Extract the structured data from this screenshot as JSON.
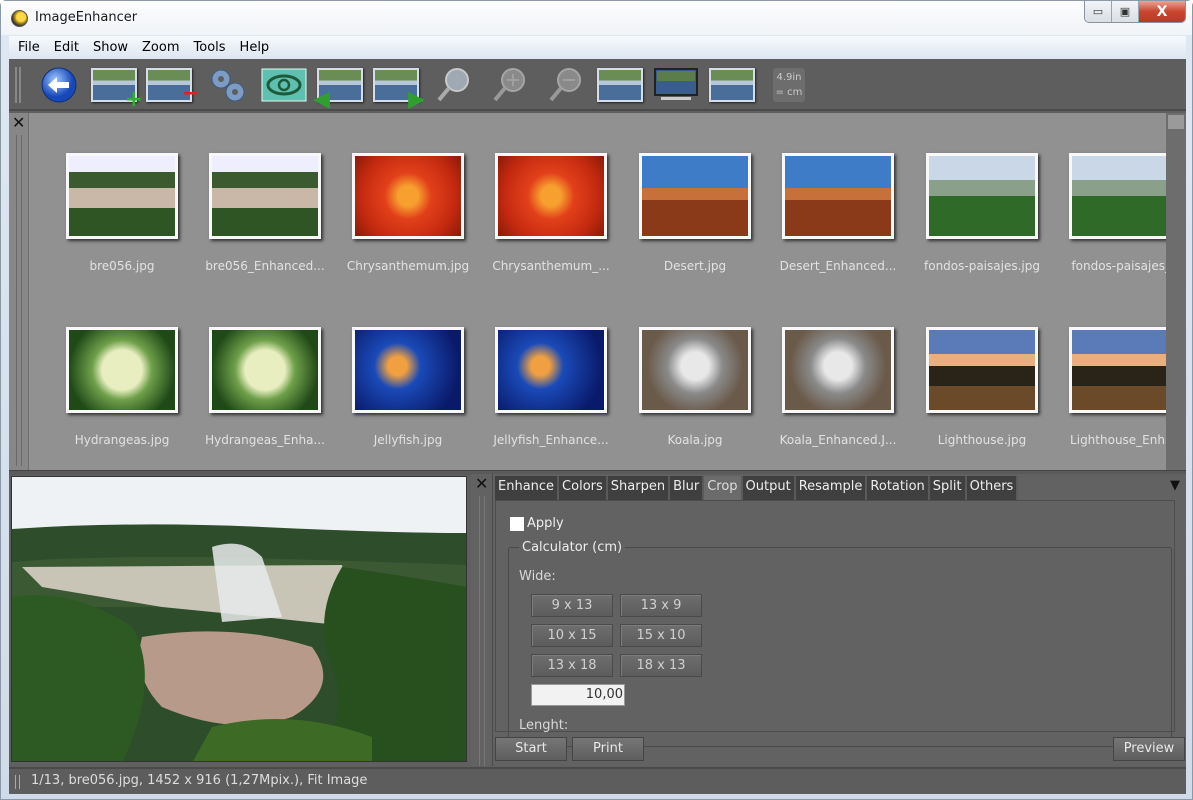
{
  "window": {
    "title": "ImageEnhancer",
    "minimize": "▭",
    "maximize": "▣",
    "close": "X"
  },
  "menu": [
    "File",
    "Edit",
    "Show",
    "Zoom",
    "Tools",
    "Help"
  ],
  "toolbar": {
    "buttons": [
      {
        "name": "back-button",
        "icon": "back-arrow-icon"
      },
      {
        "name": "add-image-button",
        "icon": "add-image-icon"
      },
      {
        "name": "remove-image-button",
        "icon": "remove-image-icon"
      },
      {
        "name": "settings-button",
        "icon": "gears-icon"
      },
      {
        "name": "view-button",
        "icon": "eye-icon"
      },
      {
        "name": "previous-image-button",
        "icon": "previous-image-icon"
      },
      {
        "name": "next-image-button",
        "icon": "next-image-icon"
      },
      {
        "name": "zoom-fit-button",
        "icon": "magnifier-icon"
      },
      {
        "name": "zoom-in-button",
        "icon": "zoom-in-icon"
      },
      {
        "name": "zoom-out-button",
        "icon": "zoom-out-icon"
      },
      {
        "name": "fit-image-button",
        "icon": "fit-image-icon"
      },
      {
        "name": "fullscreen-button",
        "icon": "monitor-icon"
      },
      {
        "name": "actual-size-button",
        "icon": "actual-size-icon"
      }
    ],
    "unit_top": "4.9in",
    "unit_bottom": "= cm"
  },
  "thumbnails": [
    {
      "caption": "bre056.jpg",
      "theme": "waterfall"
    },
    {
      "caption": "bre056_Enhanced...",
      "theme": "waterfall"
    },
    {
      "caption": "Chrysanthemum.jpg",
      "theme": "flower"
    },
    {
      "caption": "Chrysanthemum_...",
      "theme": "flower"
    },
    {
      "caption": "Desert.jpg",
      "theme": "desert"
    },
    {
      "caption": "Desert_Enhanced...",
      "theme": "desert"
    },
    {
      "caption": "fondos-paisajes.jpg",
      "theme": "mountain"
    },
    {
      "caption": "fondos-paisajes_E",
      "theme": "mountain"
    },
    {
      "caption": "Hydrangeas.jpg",
      "theme": "hydrangea"
    },
    {
      "caption": "Hydrangeas_Enha...",
      "theme": "hydrangea"
    },
    {
      "caption": "Jellyfish.jpg",
      "theme": "jellyfish"
    },
    {
      "caption": "Jellyfish_Enhance...",
      "theme": "jellyfish"
    },
    {
      "caption": "Koala.jpg",
      "theme": "koala"
    },
    {
      "caption": "Koala_Enhanced.J...",
      "theme": "koala"
    },
    {
      "caption": "Lighthouse.jpg",
      "theme": "lighthouse"
    },
    {
      "caption": "Lighthouse_Enhan",
      "theme": "lighthouse"
    }
  ],
  "tabs": [
    {
      "label": "Enhance",
      "active": false
    },
    {
      "label": "Colors",
      "active": false
    },
    {
      "label": "Sharpen",
      "active": false
    },
    {
      "label": "Blur",
      "active": false
    },
    {
      "label": "Crop",
      "active": true
    },
    {
      "label": "Output",
      "active": false
    },
    {
      "label": "Resample",
      "active": false
    },
    {
      "label": "Rotation",
      "active": false
    },
    {
      "label": "Split",
      "active": false
    },
    {
      "label": "Others",
      "active": false
    }
  ],
  "crop": {
    "apply_label": "Apply",
    "apply_checked": false,
    "calculator_label": "Calculator (cm)",
    "wide_label": "Wide:",
    "presets": [
      "9 x 13",
      "13 x 9",
      "10 x 15",
      "15 x 10",
      "13 x 18",
      "18 x 13"
    ],
    "wide_value": "10,00",
    "length_label": "Lenght:"
  },
  "actions": {
    "start": "Start",
    "print": "Print",
    "preview": "Preview"
  },
  "status": "1/13, bre056.jpg, 1452 x 916 (1,27Mpix.), Fit Image",
  "close_glyph": "✕",
  "dropdown_glyph": "▼"
}
